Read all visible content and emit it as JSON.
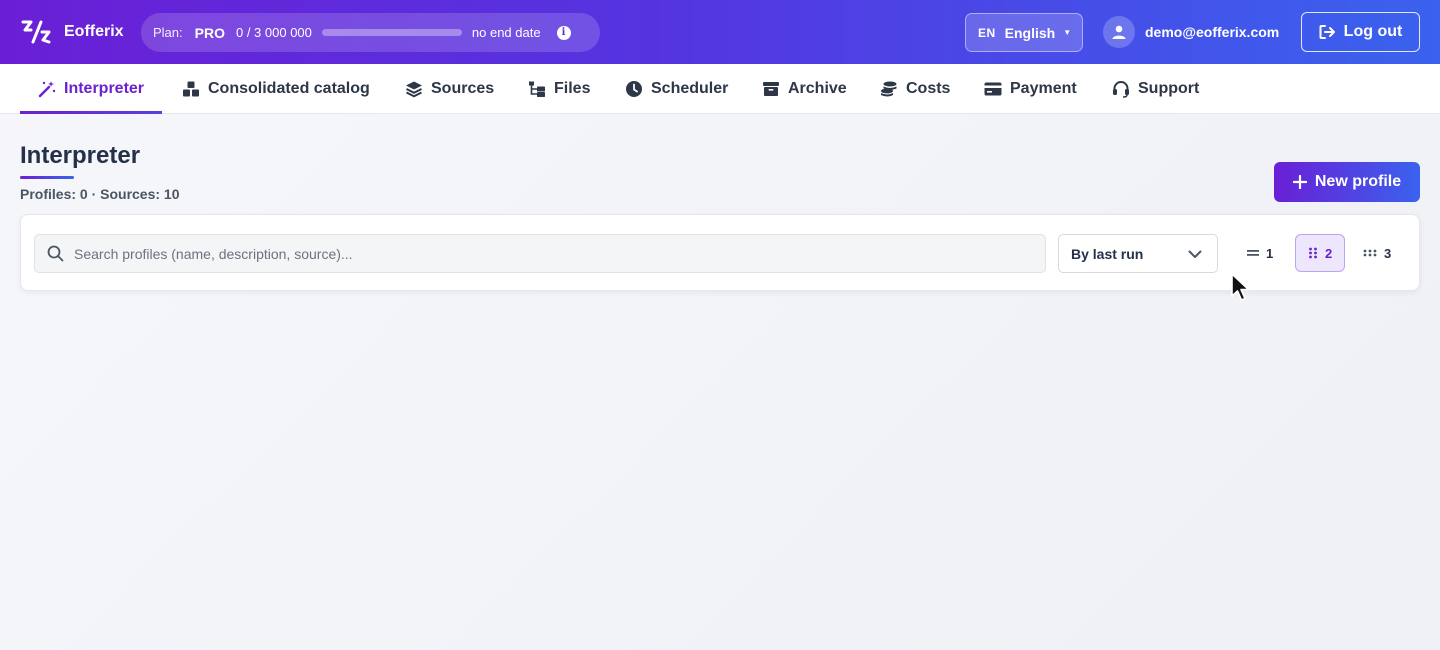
{
  "header": {
    "brand": "Eofferix",
    "plan": {
      "label": "Plan:",
      "name": "PRO",
      "usage": "0 / 3 000 000",
      "usage_fraction": 0,
      "end_date": "no end date",
      "info_icon": "info-icon"
    },
    "language": {
      "code": "EN",
      "name": "English"
    },
    "user_email": "demo@eofferix.com",
    "logout_label": "Log out"
  },
  "nav": {
    "tabs": [
      {
        "label": "Interpreter",
        "icon": "magic-wand-icon",
        "active": true
      },
      {
        "label": "Consolidated catalog",
        "icon": "cubes-icon"
      },
      {
        "label": "Sources",
        "icon": "layers-icon"
      },
      {
        "label": "Files",
        "icon": "folder-tree-icon"
      },
      {
        "label": "Scheduler",
        "icon": "clock-icon"
      },
      {
        "label": "Archive",
        "icon": "archive-box-icon"
      },
      {
        "label": "Costs",
        "icon": "coins-icon"
      },
      {
        "label": "Payment",
        "icon": "credit-card-icon"
      },
      {
        "label": "Support",
        "icon": "headset-icon"
      }
    ]
  },
  "page": {
    "title": "Interpreter",
    "stats": "Profiles: 0 · Sources: 10",
    "new_profile_label": "New profile"
  },
  "filters": {
    "search_placeholder": "Search profiles (name, description, source)...",
    "sort_value": "By last run",
    "columns": [
      {
        "label": "1",
        "icon": "one-column-icon"
      },
      {
        "label": "2",
        "icon": "two-column-icon",
        "active": true
      },
      {
        "label": "3",
        "icon": "three-column-icon"
      }
    ]
  },
  "colors": {
    "brand_purple": "#6b21d0",
    "brand_blue": "#3a62ee",
    "text_dark": "#253049",
    "background": "#f3f4f8"
  }
}
